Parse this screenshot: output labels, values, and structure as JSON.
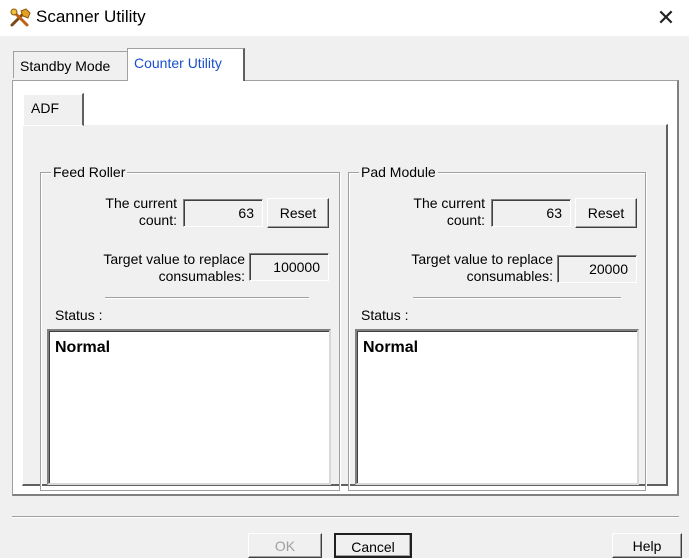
{
  "window": {
    "title": "Scanner Utility",
    "close_glyph": "✕"
  },
  "tabs": [
    {
      "label": "Standby Mode",
      "active": false
    },
    {
      "label": "Counter Utility",
      "active": true
    }
  ],
  "inner_tab": {
    "label": "ADF"
  },
  "feed_roller": {
    "legend": "Feed Roller",
    "current_count_label_1": "The current",
    "current_count_label_2": "count:",
    "current_count": "63",
    "reset_label": "Reset",
    "target_label_1": "Target value to replace",
    "target_label_2": "consumables:",
    "target_value": "100000",
    "status_label": "Status :",
    "status_value": "Normal"
  },
  "pad_module": {
    "legend": "Pad Module",
    "current_count_label_1": "The current",
    "current_count_label_2": "count:",
    "current_count": "63",
    "reset_label": "Reset",
    "target_label_1": "Target value to replace",
    "target_label_2": "consumables:",
    "target_value": "20000",
    "status_label": "Status :",
    "status_value": "Normal"
  },
  "buttons": {
    "ok": "OK",
    "cancel": "Cancel",
    "help": "Help"
  },
  "icons": {
    "app": "scanner-tools-icon",
    "close": "close-icon"
  }
}
